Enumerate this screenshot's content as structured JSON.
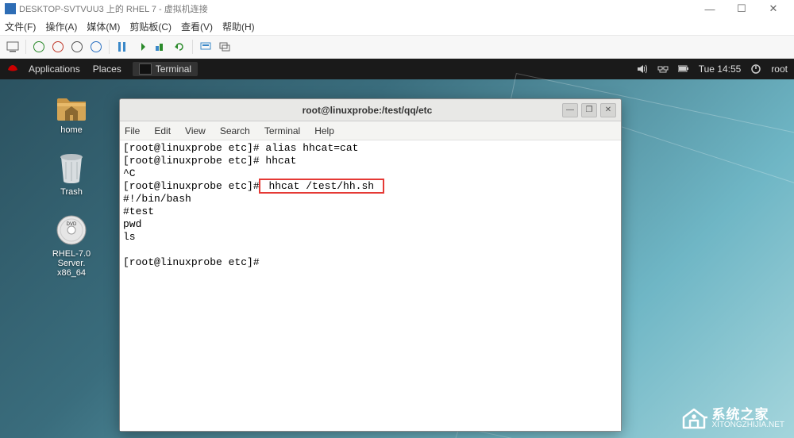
{
  "host": {
    "title": "DESKTOP-SVTVUU3 上的 RHEL 7 - 虚拟机连接",
    "menu": {
      "file": "文件(F)",
      "action": "操作(A)",
      "media": "媒体(M)",
      "clipboard": "剪贴板(C)",
      "view": "查看(V)",
      "help": "帮助(H)"
    },
    "win_min": "—",
    "win_max": "☐",
    "win_close": "✕"
  },
  "gnome": {
    "applications": "Applications",
    "places": "Places",
    "task_terminal": "Terminal",
    "clock": "Tue 14:55",
    "user": "root"
  },
  "desktop": {
    "home": "home",
    "trash": "Trash",
    "rhel_l1": "RHEL-7.0 Server.",
    "rhel_l2": "x86_64"
  },
  "terminal": {
    "title": "root@linuxprobe:/test/qq/etc",
    "menu": {
      "file": "File",
      "edit": "Edit",
      "view": "View",
      "search": "Search",
      "terminal": "Terminal",
      "help": "Help"
    },
    "lines": {
      "l1": "[root@linuxprobe etc]# alias hhcat=cat",
      "l2": "[root@linuxprobe etc]# hhcat",
      "l3": "^C",
      "l4a": "[root@linuxprobe etc]#",
      "l4b": " hhcat /test/hh.sh ",
      "l5": "#!/bin/bash",
      "l6": "#test",
      "l7": "pwd",
      "l8": "ls",
      "l9": "",
      "l10": "[root@linuxprobe etc]# "
    },
    "win_min": "—",
    "win_max": "❐",
    "win_close": "✕"
  },
  "watermark": {
    "cn": "系统之家",
    "url": "XITONGZHIJIA.NET"
  }
}
